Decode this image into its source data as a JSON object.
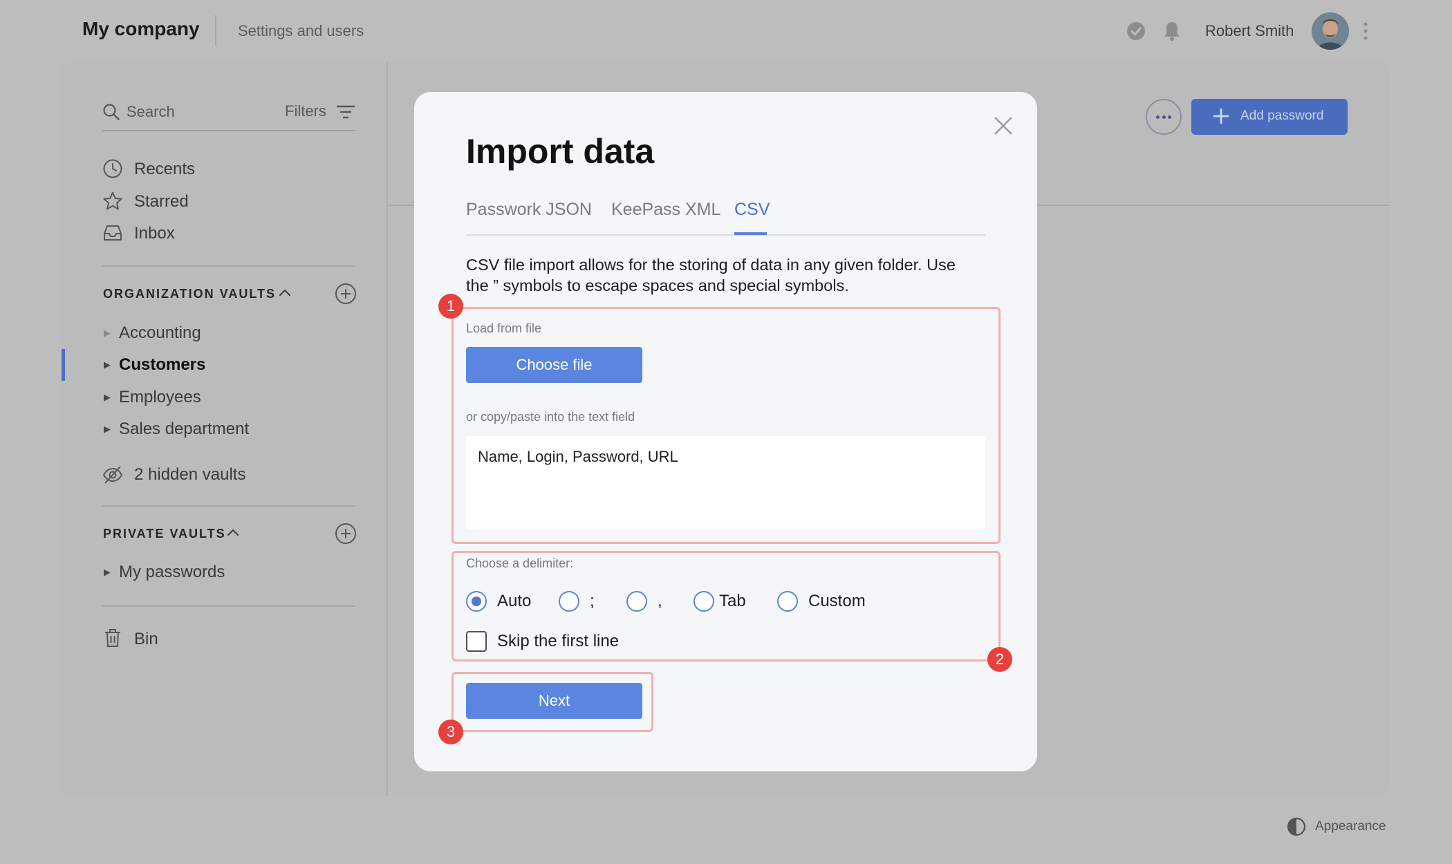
{
  "header": {
    "brand": "My company",
    "section": "Settings and users",
    "user_name": "Robert Smith"
  },
  "sidebar": {
    "search_placeholder": "Search",
    "filters_label": "Filters",
    "nav": [
      {
        "label": "Recents",
        "icon": "clock-icon"
      },
      {
        "label": "Starred",
        "icon": "star-icon"
      },
      {
        "label": "Inbox",
        "icon": "inbox-icon"
      }
    ],
    "org_vaults_title": "ORGANIZATION VAULTS",
    "org_vaults": [
      {
        "label": "Accounting",
        "active": false
      },
      {
        "label": "Customers",
        "active": true
      },
      {
        "label": "Employees",
        "active": false
      },
      {
        "label": "Sales department",
        "active": false
      }
    ],
    "hidden_vaults": "2 hidden vaults",
    "private_vaults_title": "PRIVATE VAULTS",
    "private_vaults": [
      {
        "label": "My passwords"
      }
    ],
    "bin_label": "Bin"
  },
  "toolbar": {
    "add_password_label": "Add password"
  },
  "footer": {
    "appearance_label": "Appearance"
  },
  "modal": {
    "title": "Import data",
    "tabs": [
      {
        "label": "Passwork JSON",
        "active": false
      },
      {
        "label": "KeePass XML",
        "active": false
      },
      {
        "label": "CSV",
        "active": true
      }
    ],
    "description": "CSV file import allows for the storing of data in any given folder. Use the ” symbols to escape spaces and special symbols.",
    "load_label": "Load from file",
    "choose_file_label": "Choose file",
    "paste_label": "or copy/paste into the text field",
    "textarea_value": "Name, Login, Password, URL",
    "delimiter_label": "Choose a delimiter:",
    "delimiters": [
      {
        "label": "Auto",
        "checked": true
      },
      {
        "label": ";",
        "checked": false
      },
      {
        "label": ",",
        "checked": false
      },
      {
        "label": "Tab",
        "checked": false
      },
      {
        "label": "Custom",
        "checked": false
      }
    ],
    "skip_first_line_label": "Skip the first line",
    "skip_first_line_checked": false,
    "next_label": "Next",
    "badges": [
      "1",
      "2",
      "3"
    ]
  },
  "colors": {
    "accent": "#5b86e0",
    "badge": "#e8403c",
    "highlight": "#f3b0b2",
    "overlay": "#bdbdbe"
  }
}
